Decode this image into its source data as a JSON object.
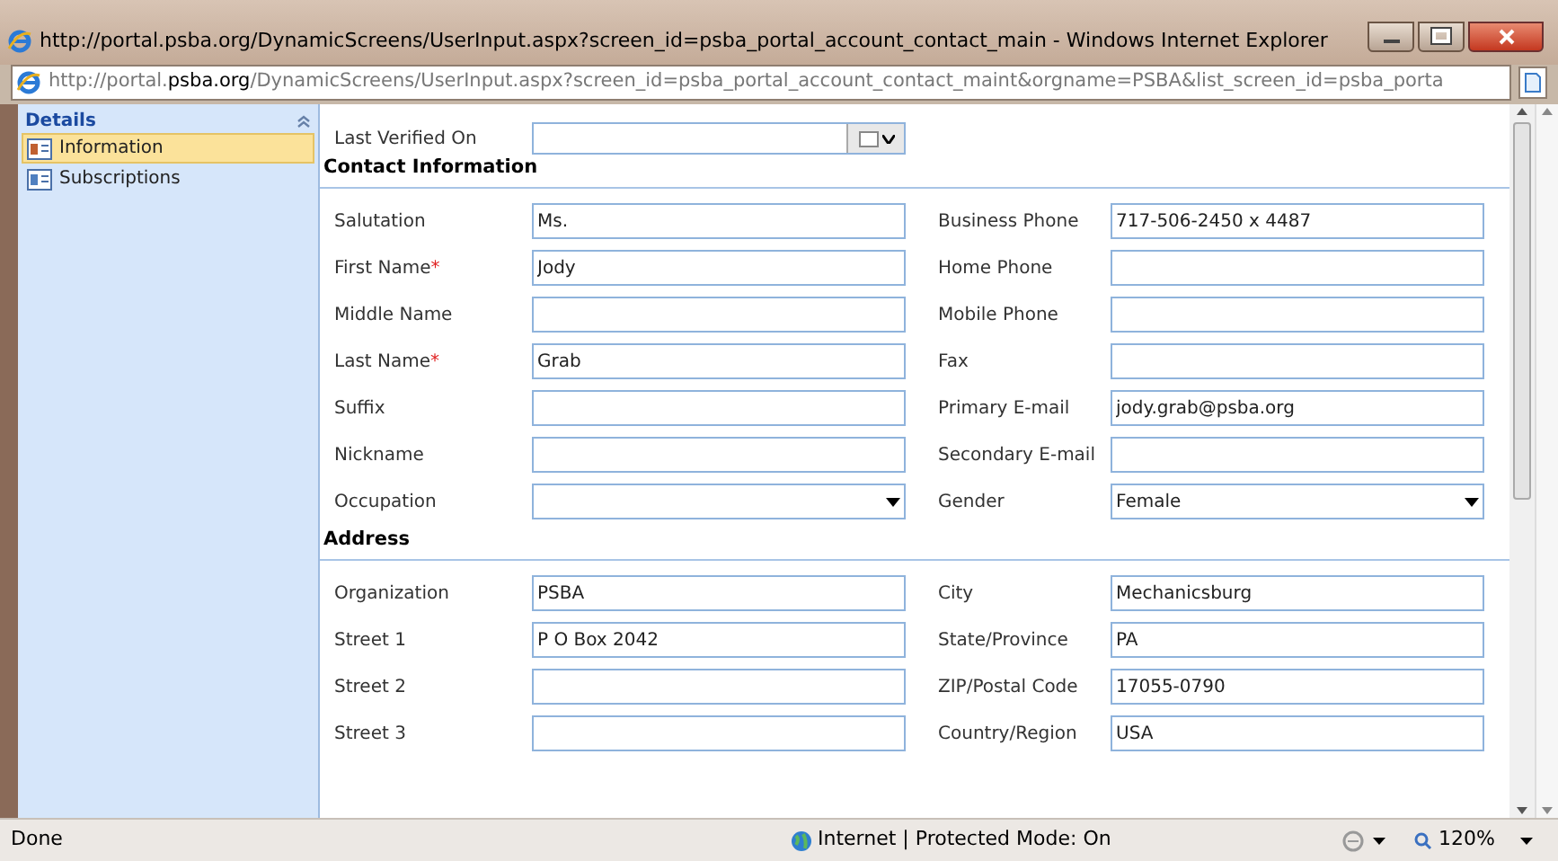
{
  "window": {
    "title": "http://portal.psba.org/DynamicScreens/UserInput.aspx?screen_id=psba_portal_account_contact_main - Windows Internet Explorer"
  },
  "address_bar": {
    "url": "http://portal.**psba.org**/DynamicScreens/UserInput.aspx?screen_id=psba_portal_account_contact_maint&orgname=PSBA&list_screen_id=psba_porta"
  },
  "sidebar": {
    "header": "Details",
    "items": [
      {
        "label": "Information",
        "selected": true
      },
      {
        "label": "Subscriptions",
        "selected": false
      }
    ]
  },
  "last_verified": {
    "label": "Last Verified On"
  },
  "sections": [
    {
      "title": "Contact Information",
      "rows": [
        [
          {
            "label": "Salutation",
            "value": "Ms.",
            "kind": "text"
          },
          {
            "label": "Business Phone",
            "value": "717-506-2450 x 4487",
            "kind": "text"
          }
        ],
        [
          {
            "label": "First Name",
            "required_mark": "*",
            "value": "Jody",
            "kind": "text"
          },
          {
            "label": "Home Phone",
            "kind": "text"
          }
        ],
        [
          {
            "label": "Middle Name",
            "kind": "text"
          },
          {
            "label": "Mobile Phone",
            "kind": "text"
          }
        ],
        [
          {
            "label": "Last Name",
            "required_mark": "*",
            "value": "Grab",
            "kind": "text"
          },
          {
            "label": "Fax",
            "kind": "text"
          }
        ],
        [
          {
            "label": "Suffix",
            "kind": "text"
          },
          {
            "label": "Primary E-mail",
            "value": "jody.grab@psba.org",
            "kind": "text"
          }
        ],
        [
          {
            "label": "Nickname",
            "kind": "text"
          },
          {
            "label": "Secondary E-mail",
            "kind": "text"
          }
        ],
        [
          {
            "label": "Occupation",
            "kind": "select"
          },
          {
            "label": "Gender",
            "value": "Female",
            "kind": "select"
          }
        ]
      ]
    },
    {
      "title": "Address",
      "rows": [
        [
          {
            "label": "Organization",
            "value": "PSBA",
            "kind": "text"
          },
          {
            "label": "City",
            "value": "Mechanicsburg",
            "kind": "text"
          }
        ],
        [
          {
            "label": "Street 1",
            "value": "P O Box 2042",
            "kind": "text"
          },
          {
            "label": "State/Province",
            "value": "PA",
            "kind": "text"
          }
        ],
        [
          {
            "label": "Street 2",
            "kind": "text"
          },
          {
            "label": "ZIP/Postal Code",
            "value": "17055-0790",
            "kind": "text"
          }
        ],
        [
          {
            "label": "Street 3",
            "kind": "text"
          },
          {
            "label": "Country/Region",
            "value": "USA",
            "kind": "text"
          }
        ]
      ]
    }
  ],
  "status_bar": {
    "text": "Done",
    "zone": "Internet | Protected Mode: On",
    "zoom": "120%"
  }
}
